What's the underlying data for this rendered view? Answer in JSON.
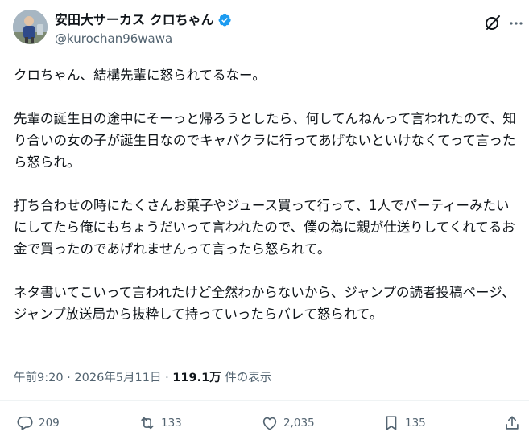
{
  "author": {
    "display_name": "安田大サーカス クロちゃん",
    "handle": "@kurochan96wawa",
    "verified_icon": "verified-badge-icon"
  },
  "post": {
    "paragraphs": [
      "クロちゃん、結構先輩に怒られてるなー。",
      "先輩の誕生日の途中にそーっと帰ろうとしたら、何してんねんって言われたので、知り合いの女の子が誕生日なのでキャバクラに行ってあげないといけなくてって言ったら怒られ。",
      "打ち合わせの時にたくさんお菓子やジュース買って行って、1人でパーティーみたいにしてたら俺にもちょうだいって言われたので、僕の為に親が仕送りしてくれてるお金で買ったのであげれませんって言ったら怒られて。",
      "ネタ書いてこいって言われたけど全然わからないから、ジャンプの読者投稿ページ、ジャンプ放送局から抜粋して持っていったらバレて怒られて。"
    ]
  },
  "meta": {
    "time": "午前9:20",
    "separator": "·",
    "date": "2026年5月11日",
    "views_count": "119.1万",
    "views_label": "件の表示"
  },
  "actions": {
    "replies": "209",
    "reposts": "133",
    "likes": "2,035",
    "bookmarks": "135"
  },
  "colors": {
    "text": "#0f1419",
    "secondary": "#536471",
    "verified": "#1d9bf0",
    "divider": "#eff3f4"
  }
}
